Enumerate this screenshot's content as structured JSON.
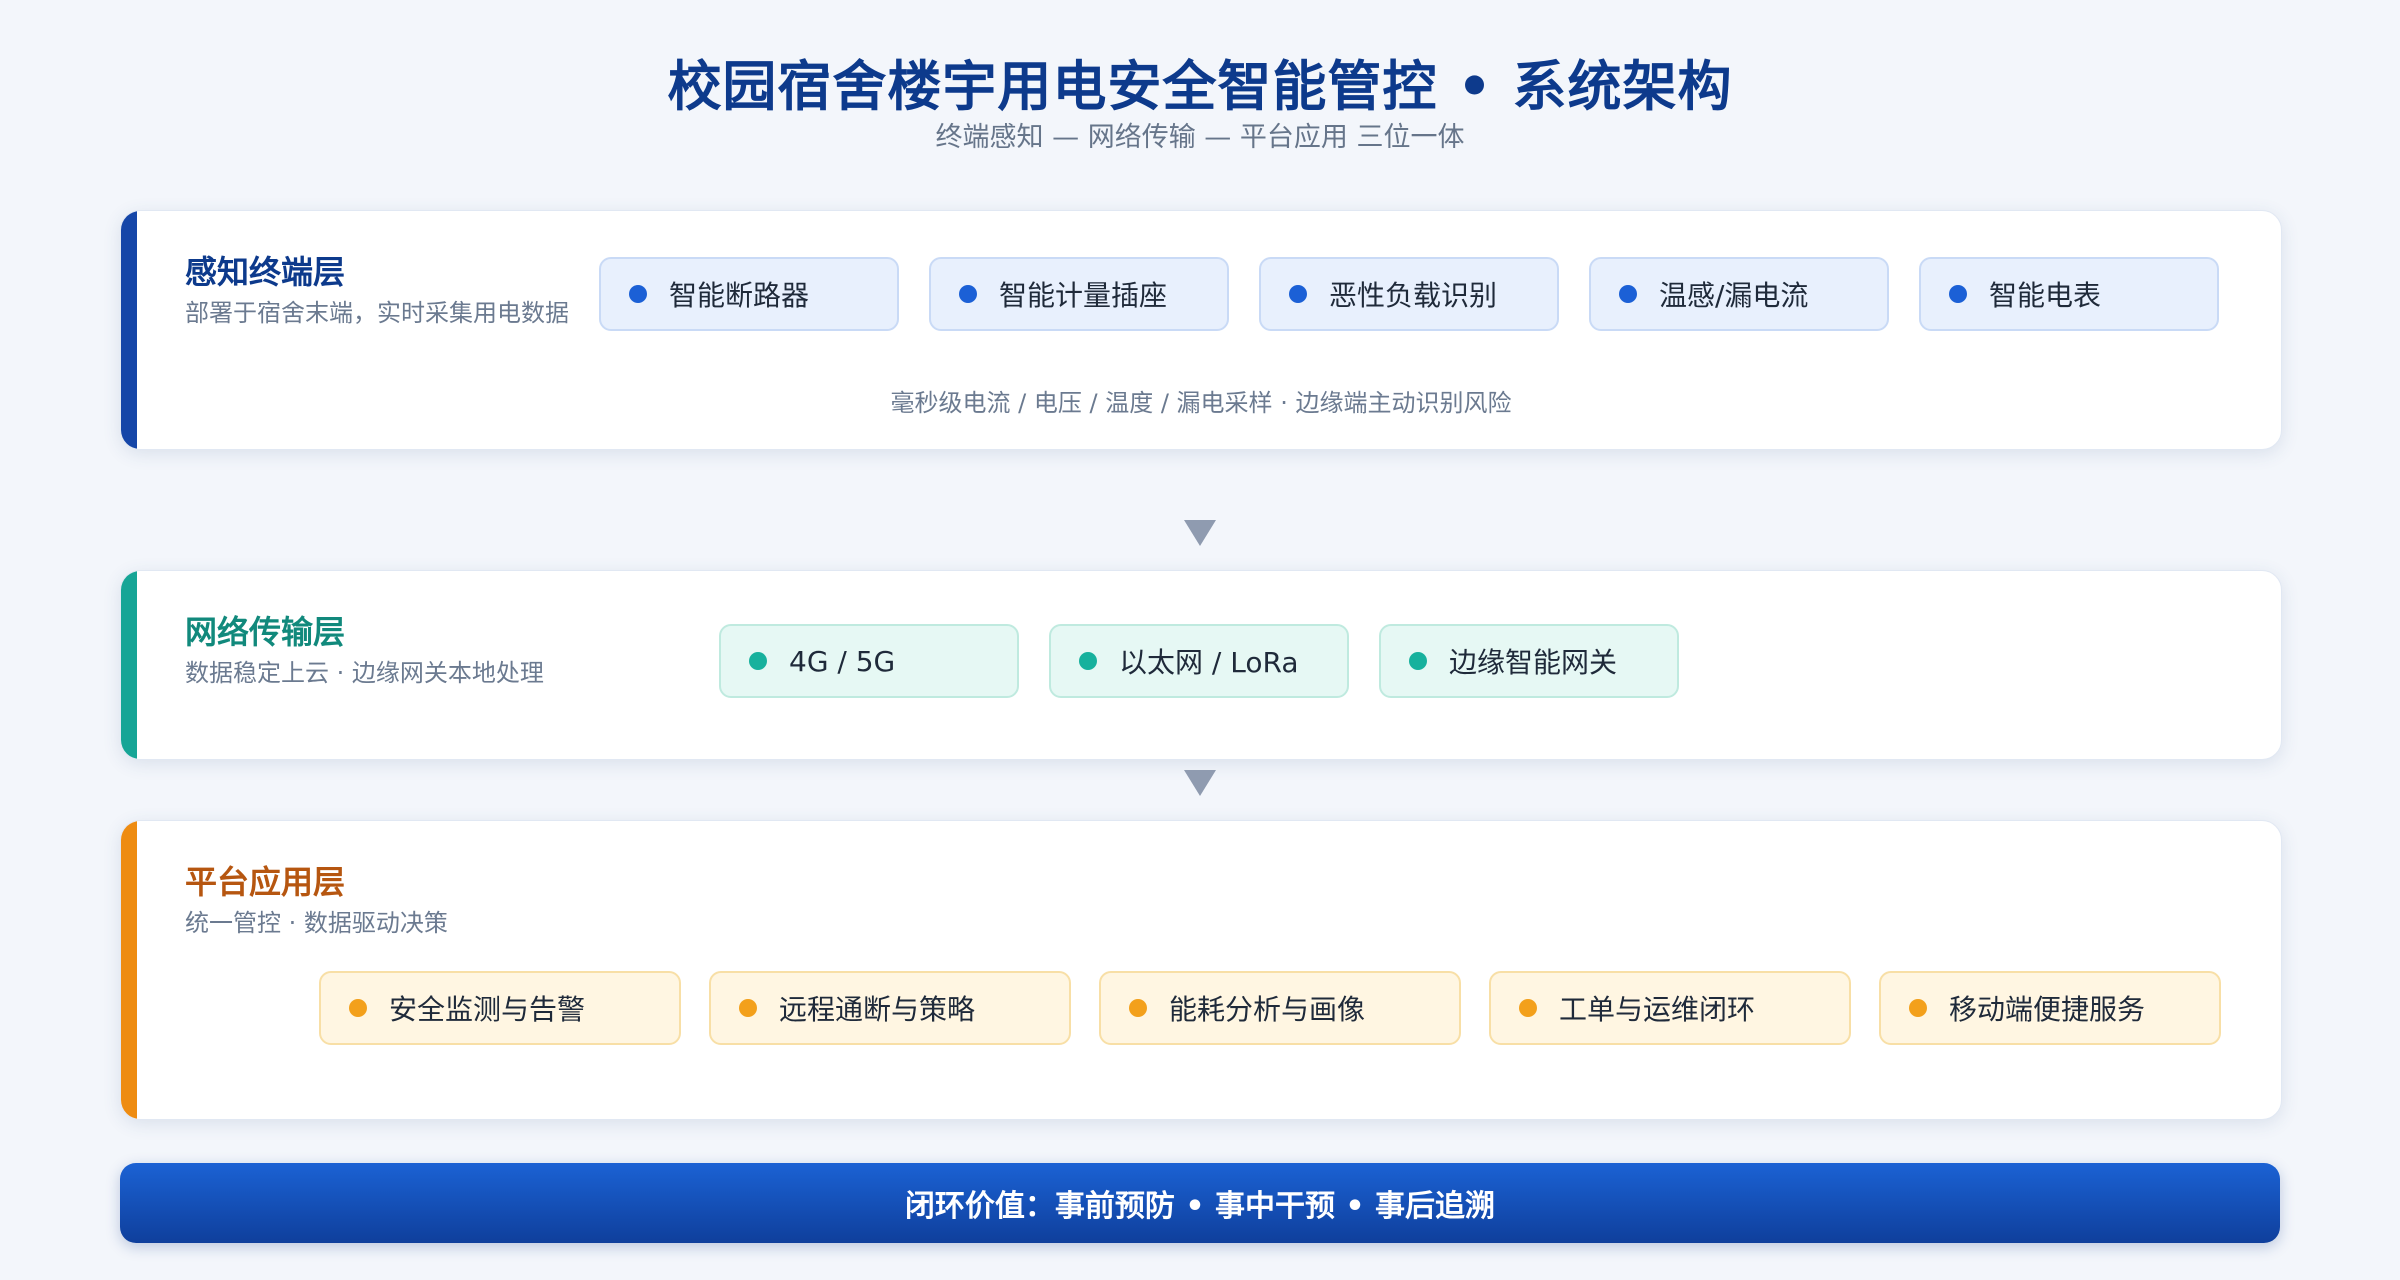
{
  "header": {
    "title": "校园宿舍楼宇用电安全智能管控 • 系统架构",
    "subtitle": "终端感知 — 网络传输 — 平台应用 三位一体"
  },
  "layers": [
    {
      "title": "感知终端层",
      "desc": "部署于宿舍末端，实时采集用电数据",
      "accent": "#1546a8",
      "items": [
        "智能断路器",
        "智能计量插座",
        "恶性负载识别",
        "温感/漏电流",
        "智能电表"
      ],
      "note": "毫秒级电流 / 电压 / 温度 / 漏电采样 · 边缘端主动识别风险"
    },
    {
      "title": "网络传输层",
      "desc": "数据稳定上云 · 边缘网关本地处理",
      "accent": "#16a596",
      "items": [
        "4G / 5G",
        "以太网 / LoRa",
        "边缘智能网关"
      ]
    },
    {
      "title": "平台应用层",
      "desc": "统一管控 · 数据驱动决策",
      "accent": "#ee8c12",
      "items": [
        "安全监测与告警",
        "远程通断与策略",
        "能耗分析与画像",
        "工单与运维闭环",
        "移动端便捷服务"
      ]
    }
  ],
  "footer": {
    "text": "闭环价值：事前预防 • 事中干预 • 事后追溯"
  },
  "icons": {
    "connector": "down-triangle-arrow",
    "bullet": "dot"
  }
}
